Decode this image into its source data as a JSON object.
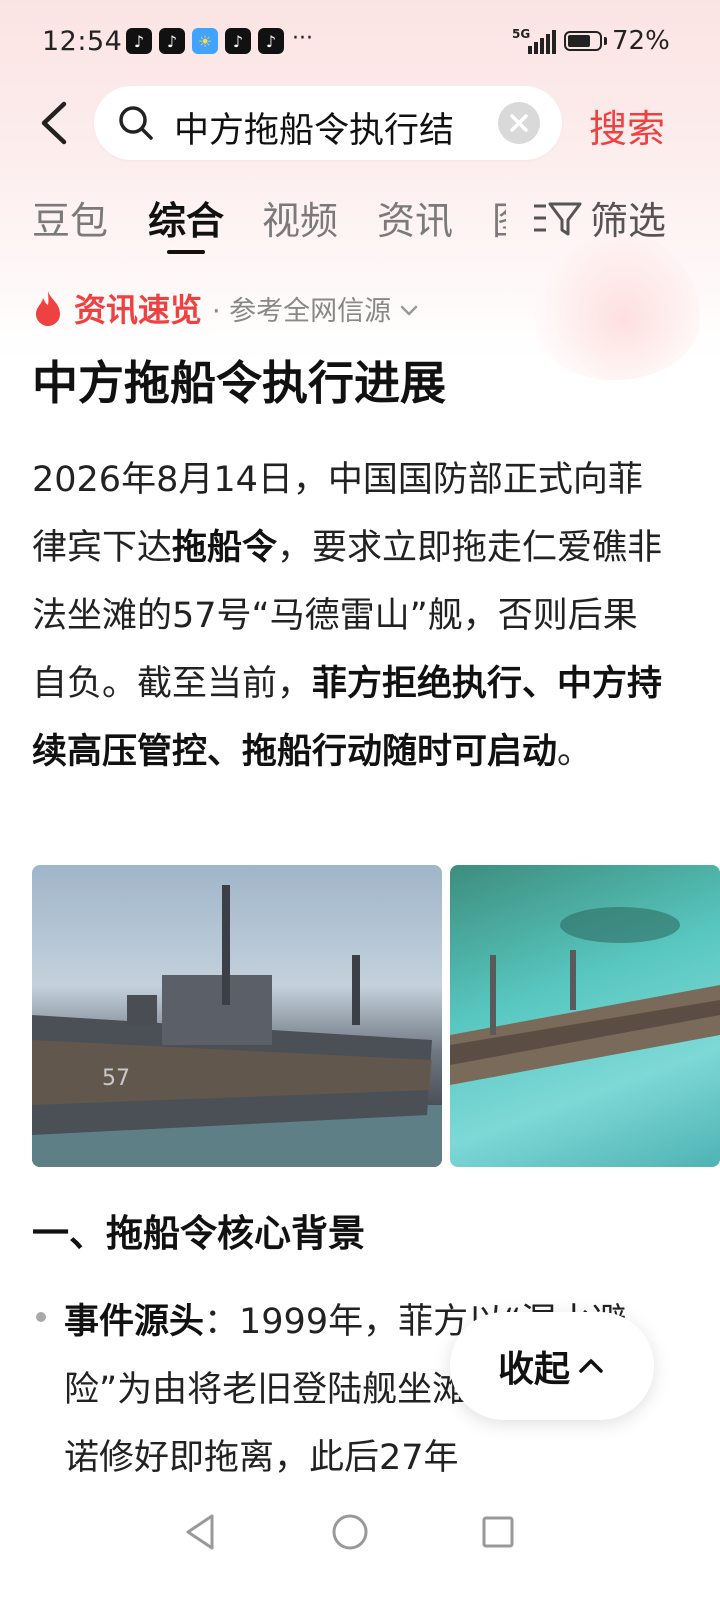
{
  "status_bar": {
    "time": "12:54",
    "network": "5G",
    "battery_pct_label": "72%",
    "battery_level": 0.72,
    "more": "···",
    "app_icons": [
      "tiktok-icon",
      "tiktok-icon",
      "weather-icon",
      "tiktok-icon",
      "tiktok-icon"
    ]
  },
  "search": {
    "query": "中方拖船令执行结",
    "button_label": "搜索"
  },
  "tabs": {
    "items": [
      "豆包",
      "综合",
      "视频",
      "资讯"
    ],
    "active": "综合",
    "clipped": "图",
    "filter_label": "筛选"
  },
  "source": {
    "title": "资讯速览",
    "subtitle": "· 参考全网信源"
  },
  "article": {
    "headline": "中方拖船令执行进展",
    "p1_a": "2026年8月14日，中国国防部正式向菲律宾下达",
    "p1_b": "拖船令",
    "p1_c": "，要求立即拖走仁爱礁非法坐滩的57号“马德雷山”舰，否则后果自负。截至当前，",
    "p1_d": "菲方拒绝执行、中方持续高压管控、拖船行动随时可启动",
    "p1_e": "。",
    "section1": "一、拖船令核心背景",
    "bullet1_label": "事件源头",
    "bullet1_text": "：1999年，菲方以“漏水避险”为由将老旧登陆舰坐滩仁爱礁，承诺修好即拖离，此后27年"
  },
  "collapse": {
    "label": "收起"
  },
  "colors": {
    "accent": "#f04142",
    "tab_inactive": "#7a7a7a"
  }
}
